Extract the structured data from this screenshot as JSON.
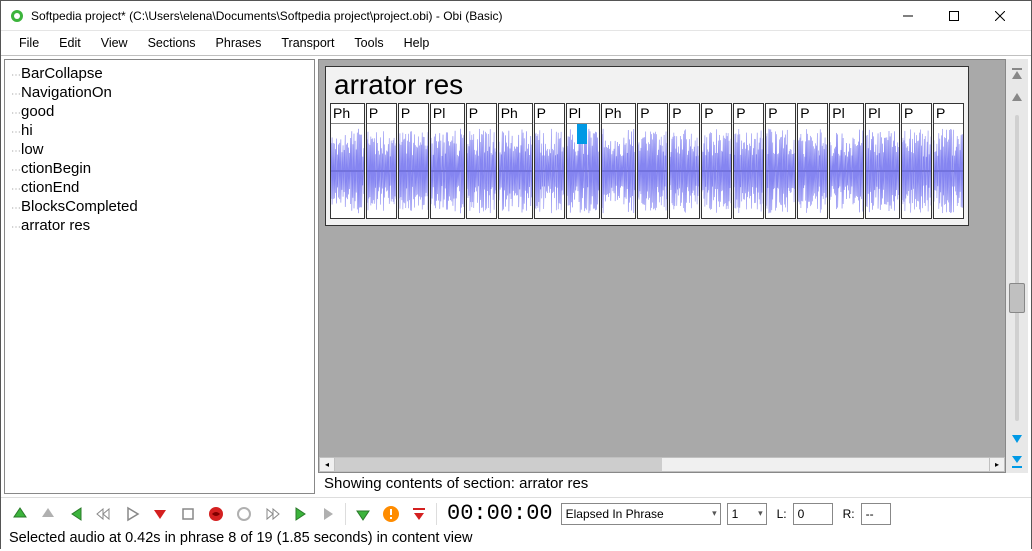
{
  "window": {
    "title": "Softpedia project* (C:\\Users\\elena\\Documents\\Softpedia project\\project.obi) - Obi (Basic)"
  },
  "menu": {
    "items": [
      "File",
      "Edit",
      "View",
      "Sections",
      "Phrases",
      "Transport",
      "Tools",
      "Help"
    ]
  },
  "nav": {
    "items": [
      "BarCollapse",
      "NavigationOn",
      "good",
      "hi",
      "low",
      "ctionBegin",
      "ctionEnd",
      "BlocksCompleted",
      "arrator res"
    ]
  },
  "section": {
    "title": "arrator res",
    "phrases": [
      {
        "label": "Ph",
        "wide": true
      },
      {
        "label": "P"
      },
      {
        "label": "P"
      },
      {
        "label": "Pl",
        "wide": true
      },
      {
        "label": "P"
      },
      {
        "label": "Ph",
        "wide": true
      },
      {
        "label": "P"
      },
      {
        "label": "Pl",
        "wide": true,
        "cursor": true
      },
      {
        "label": "Ph",
        "wide": true
      },
      {
        "label": "P"
      },
      {
        "label": "P"
      },
      {
        "label": "P"
      },
      {
        "label": "P"
      },
      {
        "label": "P"
      },
      {
        "label": "P"
      },
      {
        "label": "Pl",
        "wide": true
      },
      {
        "label": "Pl",
        "wide": true
      },
      {
        "label": "P"
      },
      {
        "label": "P"
      }
    ],
    "info": "Showing contents of section:  arrator res"
  },
  "transport": {
    "time": "00:00:00",
    "mode": "Elapsed In Phrase",
    "speed": "1",
    "l_label": "L:",
    "l_value": "0",
    "r_label": "R:",
    "r_value": "--"
  },
  "status": {
    "text": "Selected audio at 0.42s in phrase 8 of 19 (1.85 seconds) in content view"
  },
  "colors": {
    "wave": "#7070ee",
    "cursor": "#0099e5",
    "arrow_green": "#3cb43c",
    "arrow_blue": "#0099e5",
    "record_red": "#d42020",
    "alert_orange": "#ff8c00"
  }
}
